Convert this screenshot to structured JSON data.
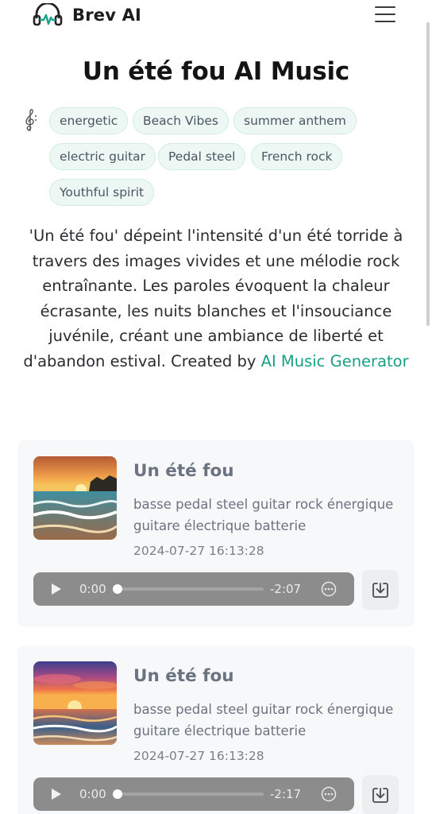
{
  "brand": {
    "name": "Brev AI",
    "accent": "#1aa58a"
  },
  "page": {
    "title": "Un été fou AI Music",
    "tags": [
      "energetic",
      "Beach Vibes",
      "summer anthem",
      "electric guitar",
      "Pedal steel",
      "French rock",
      "Youthful spirit"
    ],
    "description_text": "'Un été fou' dépeint l'intensité d'un été torride à travers des images vivides et une mélodie rock entraînante. Les paroles évoquent la chaleur écrasante, les nuits blanches et l'insouciance juvénile, créant une ambiance de liberté et d'abandon estival. Created by ",
    "description_link": "AI Music Generator"
  },
  "songs": [
    {
      "title": "Un été fou",
      "description": "basse pedal steel guitar rock énergique guitare électrique batterie",
      "date": "2024-07-27 16:13:28",
      "player": {
        "current_time": "0:00",
        "remaining_time": "-2:07",
        "progress": 0
      }
    },
    {
      "title": "Un été fou",
      "description": "basse pedal steel guitar rock énergique guitare électrique batterie",
      "date": "2024-07-27 16:13:28",
      "player": {
        "current_time": "0:00",
        "remaining_time": "-2:17",
        "progress": 0
      }
    }
  ]
}
